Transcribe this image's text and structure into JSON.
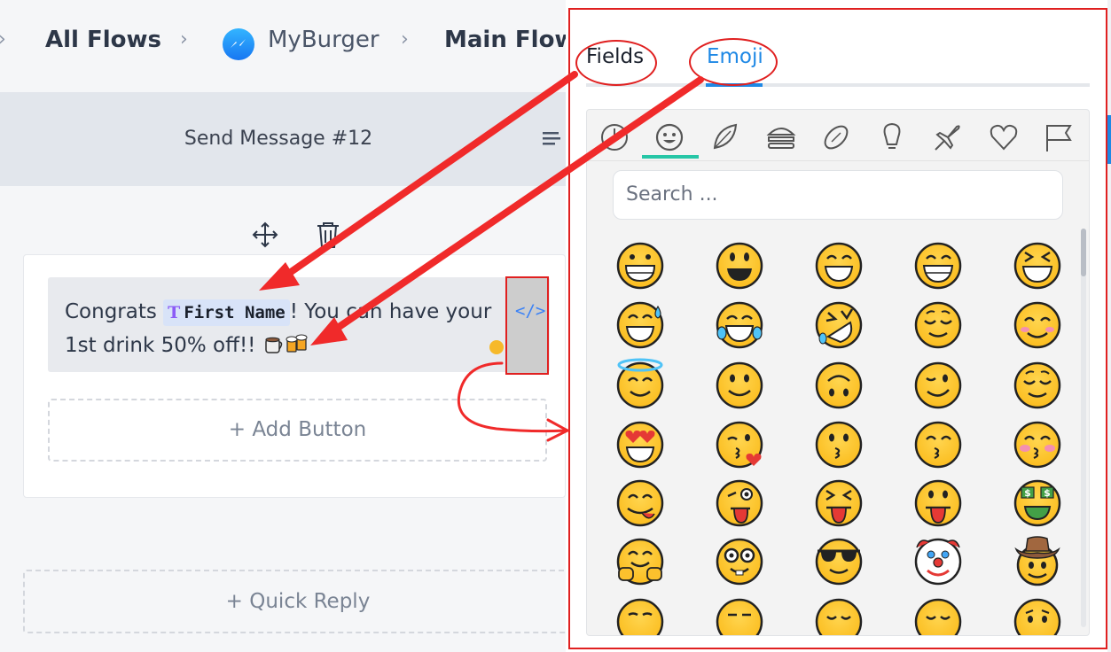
{
  "breadcrumb": {
    "items": [
      {
        "label": "All Flows"
      },
      {
        "label": "MyBurger"
      },
      {
        "label": "Main Flow"
      }
    ]
  },
  "node": {
    "title": "Send Message #12",
    "message": {
      "text_before": "Congrats ",
      "field_label": "First Name",
      "text_after": "! You can have your 1st drink 50% off!! ",
      "inline_emojis": [
        "hot-beverage",
        "beer-mugs"
      ]
    },
    "add_button_label": "+ Add Button",
    "quick_reply_label": "+ Quick Reply",
    "code_button_glyph": "</>"
  },
  "picker": {
    "tabs": [
      {
        "label": "Fields",
        "active": false
      },
      {
        "label": "Emoji",
        "active": true
      }
    ],
    "categories": [
      "clock-icon",
      "smiley-icon",
      "leaf-icon",
      "burger-icon",
      "football-icon",
      "lightbulb-icon",
      "airplane-icon",
      "heart-icon",
      "flag-icon"
    ],
    "active_category": "smiley-icon",
    "search_placeholder": "Search ...",
    "emoji_rows": [
      [
        "grinning-face",
        "grinning-face-big-eyes",
        "grinning-face-smiling-eyes",
        "beaming-face",
        "grinning-squinting-face"
      ],
      [
        "grinning-face-sweat",
        "face-tears-of-joy",
        "rolling-on-floor-laughing",
        "relieved-face",
        "smiling-face-smiling-eyes"
      ],
      [
        "smiling-face-halo",
        "slightly-smiling-face",
        "upside-down-face",
        "winking-face",
        "relieved-face"
      ],
      [
        "smiling-face-heart-eyes",
        "face-blowing-kiss",
        "kissing-face",
        "kissing-face-smiling-eyes",
        "kissing-face-closed-eyes"
      ],
      [
        "face-savoring-food",
        "winking-face-tongue",
        "squinting-face-tongue",
        "face-with-tongue",
        "money-mouth-face"
      ],
      [
        "hugging-face",
        "nerd-face",
        "smiling-face-sunglasses",
        "clown-face",
        "cowboy-hat-face"
      ],
      [
        "smirking-face",
        "unamused-face",
        "pensive-face",
        "disappointed-face",
        "worried-face"
      ]
    ]
  },
  "colors": {
    "accent_blue": "#1e88e5",
    "annotation_red": "#e02020",
    "category_underline": "#26c6a6",
    "field_chip": "#d8e3f8",
    "emoji_yellow": "#fcc21b"
  }
}
